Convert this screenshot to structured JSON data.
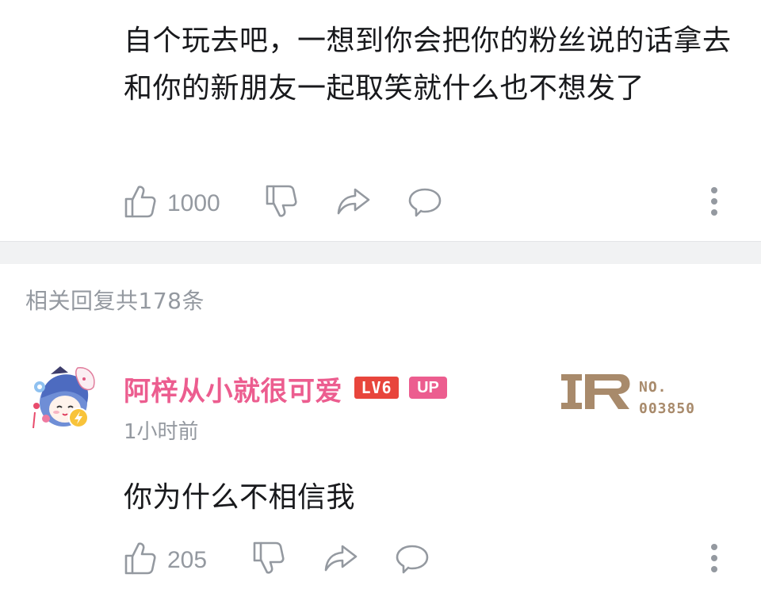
{
  "comment": {
    "text": "自个玩去吧，一想到你会把你的粉丝说的话拿去和你的新朋友一起取笑就什么也不想发了",
    "like_count": "1000"
  },
  "replies": {
    "header": "相关回复共178条",
    "items": [
      {
        "username": "阿梓从小就很可爱",
        "level_badge": "LV6",
        "up_badge": "UP",
        "timestamp": "1小时前",
        "fan_badge_label": "NO.",
        "fan_badge_number": "003850",
        "text": "你为什么不相信我",
        "like_count": "205"
      }
    ]
  },
  "icons": {
    "like": "thumbs-up-icon",
    "dislike": "thumbs-down-icon",
    "share": "share-icon",
    "reply": "comment-icon",
    "more": "more-vertical-icon"
  },
  "colors": {
    "text_primary": "#18191c",
    "text_secondary": "#9499a0",
    "username_pink": "#ec5d8f",
    "level_red": "#e8453c",
    "fan_badge_gold": "#a88a6b",
    "divider": "#f1f2f3"
  }
}
